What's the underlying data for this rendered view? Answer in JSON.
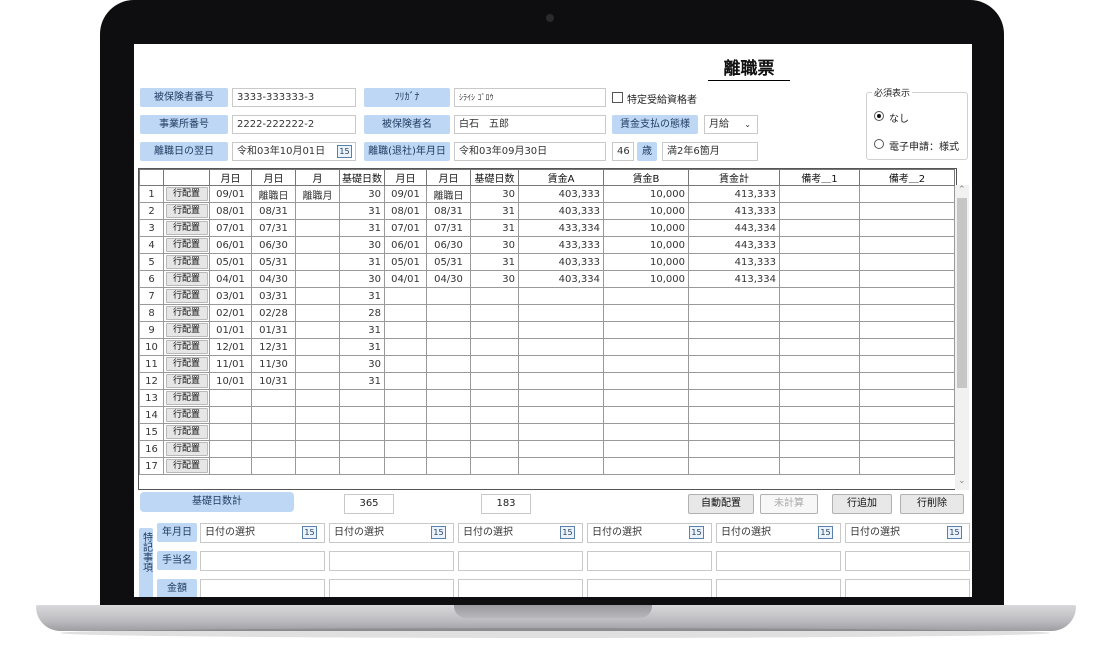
{
  "title": "離職票",
  "header": {
    "insured_no_label": "被保険者番号",
    "insured_no": "3333-333333-3",
    "furigana_label": "ﾌﾘｶﾞﾅ",
    "furigana": "ｼﾗｲｼ ｺﾞﾛｳ",
    "special_label": "特定受給資格者",
    "office_no_label": "事業所番号",
    "office_no": "2222-222222-2",
    "insured_name_label": "被保険者名",
    "insured_name": "白石　五郎",
    "wage_type_label": "賃金支払の態様",
    "wage_type": "月給",
    "next_day_label": "離職日の翌日",
    "next_day": "令和03年10月01日",
    "leave_date_label": "離職(退社)年月日",
    "leave_date": "令和03年09月30日",
    "age": "46",
    "age_unit": "歳",
    "tenure": "満2年6箇月",
    "calendar_glyph": "15"
  },
  "required_display": {
    "legend": "必須表示",
    "option_none": "なし",
    "option_electronic": "電子申請：様式"
  },
  "table": {
    "headers": [
      "",
      "",
      "月日",
      "月日",
      "月",
      "基礎日数",
      "月日",
      "月日",
      "基礎日数",
      "賃金A",
      "賃金B",
      "賃金計",
      "備考＿1",
      "備考＿2"
    ],
    "assign_label": "行配置",
    "rows": [
      [
        "1",
        "09/01",
        "離職日",
        "離職月",
        "30",
        "09/01",
        "離職日",
        "30",
        "403,333",
        "10,000",
        "413,333"
      ],
      [
        "2",
        "08/01",
        "08/31",
        "",
        "31",
        "08/01",
        "08/31",
        "31",
        "403,333",
        "10,000",
        "413,333"
      ],
      [
        "3",
        "07/01",
        "07/31",
        "",
        "31",
        "07/01",
        "07/31",
        "31",
        "433,334",
        "10,000",
        "443,334"
      ],
      [
        "4",
        "06/01",
        "06/30",
        "",
        "30",
        "06/01",
        "06/30",
        "30",
        "433,333",
        "10,000",
        "443,333"
      ],
      [
        "5",
        "05/01",
        "05/31",
        "",
        "31",
        "05/01",
        "05/31",
        "31",
        "403,333",
        "10,000",
        "413,333"
      ],
      [
        "6",
        "04/01",
        "04/30",
        "",
        "30",
        "04/01",
        "04/30",
        "30",
        "403,334",
        "10,000",
        "413,334"
      ],
      [
        "7",
        "03/01",
        "03/31",
        "",
        "31",
        "",
        "",
        "",
        "",
        "",
        ""
      ],
      [
        "8",
        "02/01",
        "02/28",
        "",
        "28",
        "",
        "",
        "",
        "",
        "",
        ""
      ],
      [
        "9",
        "01/01",
        "01/31",
        "",
        "31",
        "",
        "",
        "",
        "",
        "",
        ""
      ],
      [
        "10",
        "12/01",
        "12/31",
        "",
        "31",
        "",
        "",
        "",
        "",
        "",
        ""
      ],
      [
        "11",
        "11/01",
        "11/30",
        "",
        "30",
        "",
        "",
        "",
        "",
        "",
        ""
      ],
      [
        "12",
        "10/01",
        "10/31",
        "",
        "31",
        "",
        "",
        "",
        "",
        "",
        ""
      ],
      [
        "13",
        "",
        "",
        "",
        "",
        "",
        "",
        "",
        "",
        "",
        ""
      ],
      [
        "14",
        "",
        "",
        "",
        "",
        "",
        "",
        "",
        "",
        "",
        ""
      ],
      [
        "15",
        "",
        "",
        "",
        "",
        "",
        "",
        "",
        "",
        "",
        ""
      ],
      [
        "16",
        "",
        "",
        "",
        "",
        "",
        "",
        "",
        "",
        "",
        ""
      ],
      [
        "17",
        "",
        "",
        "",
        "",
        "",
        "",
        "",
        "",
        "",
        ""
      ]
    ]
  },
  "footer": {
    "basis_total_label": "基礎日数計",
    "total_a": "365",
    "total_b": "183",
    "auto_assign": "自動配置",
    "uncalculated": "未計算",
    "add_row": "行追加",
    "delete_row": "行削除"
  },
  "special_notes": {
    "section_label": "特記事項",
    "date_label": "年月日",
    "allowance_label": "手当名",
    "amount_label": "金額",
    "date_placeholder": "日付の選択"
  }
}
